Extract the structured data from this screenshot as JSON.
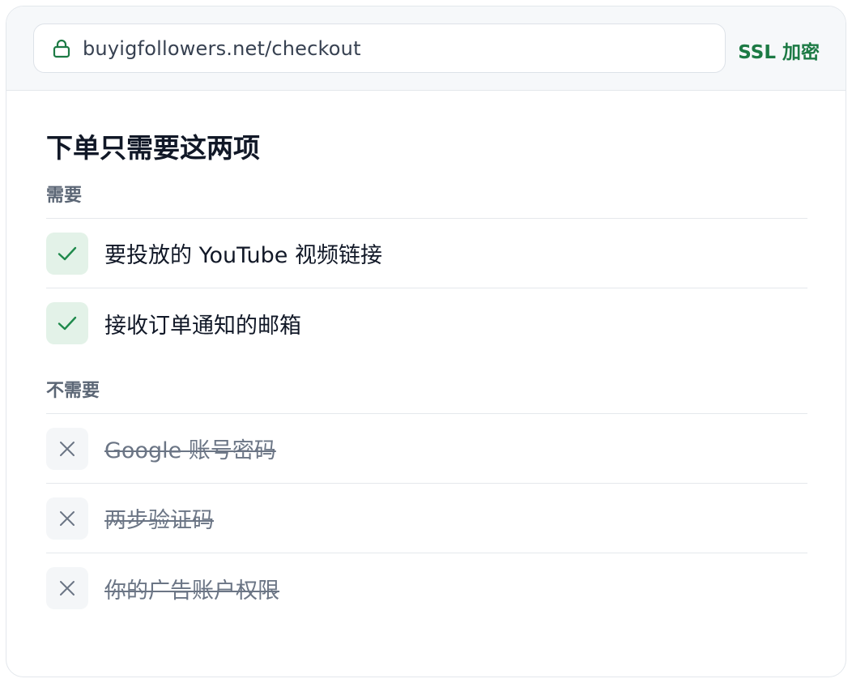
{
  "browser": {
    "url": "buyigfollowers.net/checkout",
    "security_label": "SSL 加密",
    "icons": {
      "lock": "lock-icon"
    },
    "colors": {
      "secure": "#1c7a44"
    }
  },
  "main": {
    "title": "下单只需要这两项",
    "needed": {
      "label": "需要",
      "items": [
        {
          "text": "要投放的 YouTube 视频链接",
          "icon": "check-icon"
        },
        {
          "text": "接收订单通知的邮箱",
          "icon": "check-icon"
        }
      ]
    },
    "not_needed": {
      "label": "不需要",
      "items": [
        {
          "text": "Google 账号密码",
          "icon": "x-icon"
        },
        {
          "text": "两步验证码",
          "icon": "x-icon"
        },
        {
          "text": "你的广告账户权限",
          "icon": "x-icon"
        }
      ]
    }
  }
}
